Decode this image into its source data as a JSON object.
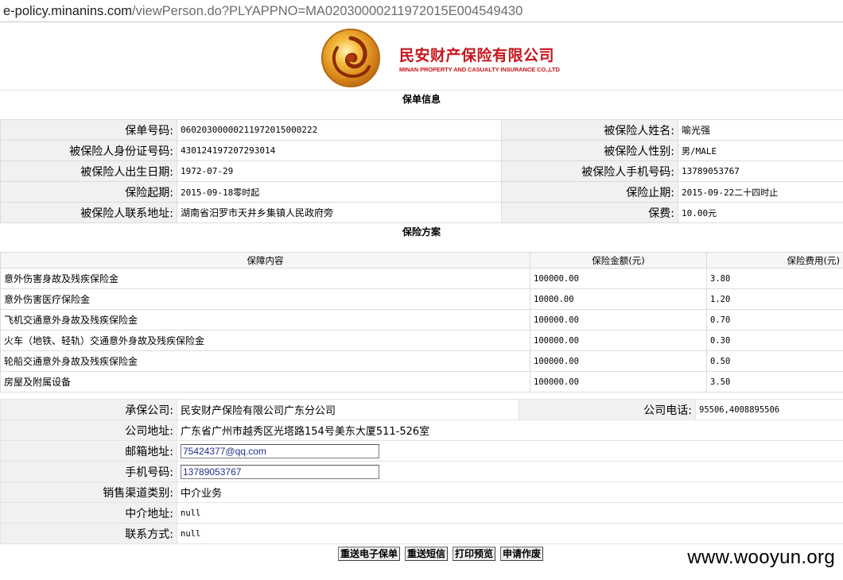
{
  "url": {
    "host": "e-policy.minanins.com",
    "path": "/viewPerson.do?PLYAPPNO=MA02030000211972015E004549430"
  },
  "logo": {
    "cn": "民安财产保险有限公司",
    "en": "MINAN PROPERTY AND CASUALTY INSURANCE CO.,LTD"
  },
  "policy": {
    "title": "保单信息",
    "rows": [
      {
        "l1": "保单号码:",
        "v1": "060203000002119720150002​22",
        "l2": "被保险人姓名:",
        "v2": "喻光强"
      },
      {
        "l1": "被保险人身份证号码:",
        "v1": "430124197207293014",
        "l2": "被保险人性别:",
        "v2": "男/MALE"
      },
      {
        "l1": "被保险人出生日期:",
        "v1": "1972-07-29",
        "l2": "被保险人手机号码:",
        "v2": "13789053767"
      },
      {
        "l1": "保险起期:",
        "v1": "2015-09-18零时起",
        "l2": "保险止期:",
        "v2": "2015-09-22二十四时止"
      },
      {
        "l1": "被保险人联系地址:",
        "v1": "湖南省汨罗市天井乡集镇人民政府旁",
        "l2": "保费:",
        "v2": "10.00元"
      }
    ]
  },
  "plan": {
    "title": "保险方案",
    "headers": [
      "保障内容",
      "保险金额(元)",
      "保险费用(元)"
    ],
    "rows": [
      {
        "item": "意外伤害身故及残疾保险金",
        "amount": "100000.00",
        "fee": "3.80"
      },
      {
        "item": "意外伤害医疗保险金",
        "amount": "10000.00",
        "fee": "1.20"
      },
      {
        "item": "飞机交通意外身故及残疾保险金",
        "amount": "100000.00",
        "fee": "0.70"
      },
      {
        "item": "火车（地铁、轻轨）交通意外身故及残疾保险金",
        "amount": "100000.00",
        "fee": "0.30"
      },
      {
        "item": "轮船交通意外身故及残疾保险金",
        "amount": "100000.00",
        "fee": "0.50"
      },
      {
        "item": "房屋及附属设备",
        "amount": "100000.00",
        "fee": "3.50"
      }
    ]
  },
  "company": {
    "insurer_label": "承保公司:",
    "insurer": "民安财产保险有限公司广东分公司",
    "phone_label": "公司电话:",
    "phone": "95506,4008895506",
    "address_label": "公司地址:",
    "address": "广东省广州市越秀区光塔路154号美东大厦511-526室",
    "email_label": "邮箱地址:",
    "email": "75424377@qq.com",
    "mobile_label": "手机号码:",
    "mobile": "13789053767",
    "channel_label": "销售渠道类别:",
    "channel": "中介业务",
    "agent_addr_label": "中介地址:",
    "agent_addr": "null",
    "contact_label": "联系方式:",
    "contact": "null"
  },
  "buttons": {
    "resend_policy": "重送电子保单",
    "resend_sms": "重送短信",
    "print_preview": "打印预览",
    "void": "申请作废"
  },
  "watermark": "www.wooyun.org",
  "colors": {
    "brand_red": "#c8161d",
    "logo_gold": "#f3b93a"
  }
}
